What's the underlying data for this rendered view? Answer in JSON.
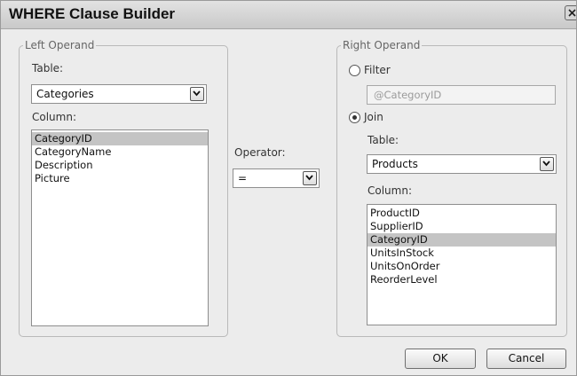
{
  "window": {
    "title": "WHERE Clause Builder"
  },
  "left_operand": {
    "legend": "Left Operand",
    "table_label": "Table:",
    "table_value": "Categories",
    "column_label": "Column:",
    "columns": [
      "CategoryID",
      "CategoryName",
      "Description",
      "Picture"
    ],
    "selected_column": "CategoryID"
  },
  "operator": {
    "label": "Operator:",
    "value": "="
  },
  "right_operand": {
    "legend": "Right Operand",
    "filter_label": "Filter",
    "filter_selected": false,
    "filter_value": "@CategoryID",
    "join_label": "Join",
    "join_selected": true,
    "table_label": "Table:",
    "table_value": "Products",
    "column_label": "Column:",
    "columns": [
      "ProductID",
      "SupplierID",
      "CategoryID",
      "UnitsInStock",
      "UnitsOnOrder",
      "ReorderLevel"
    ],
    "selected_column": "CategoryID"
  },
  "buttons": {
    "ok": "OK",
    "cancel": "Cancel"
  }
}
